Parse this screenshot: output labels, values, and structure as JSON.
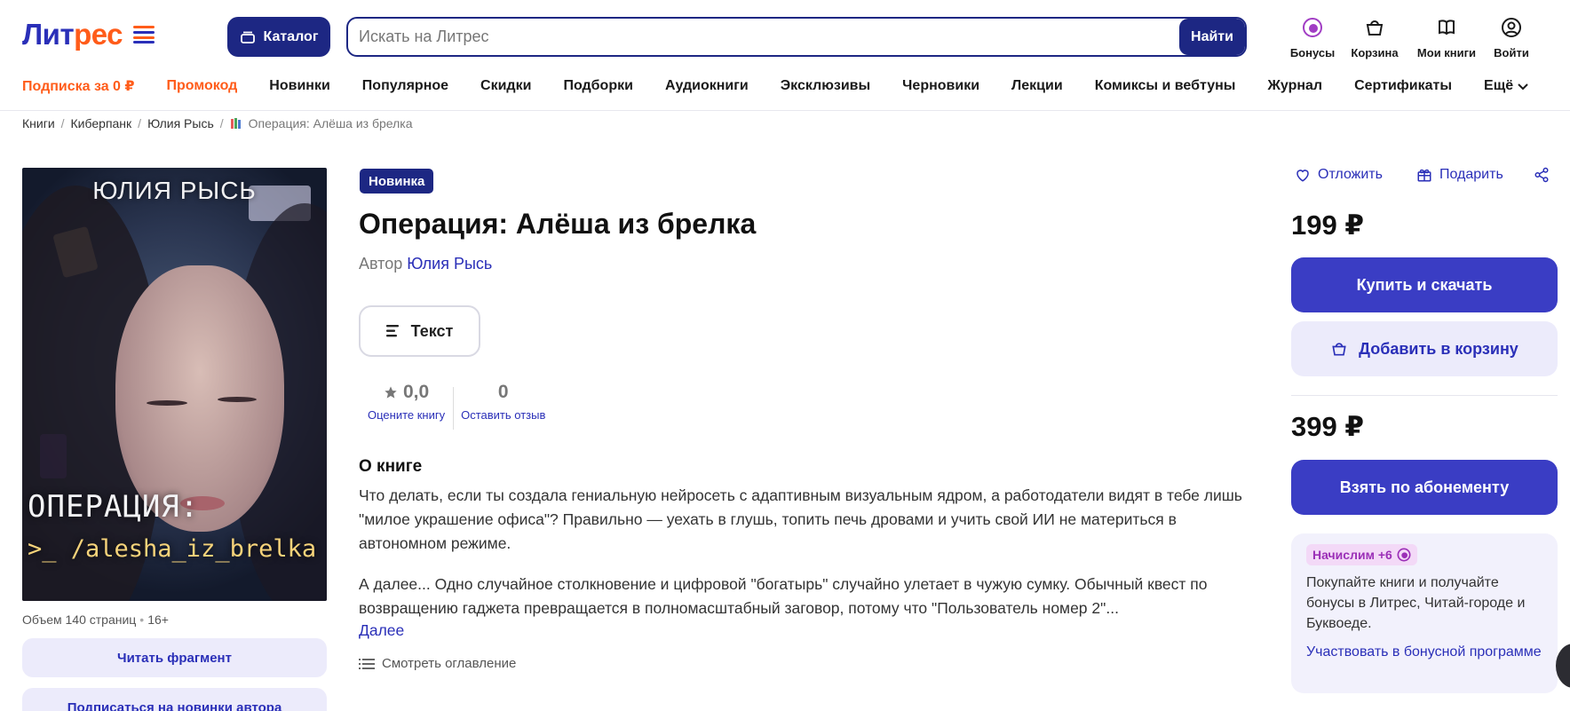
{
  "header": {
    "logo": {
      "part1": "Лит",
      "part2": "рес"
    },
    "catalog_label": "Каталог",
    "search": {
      "placeholder": "Искать на Литрес",
      "button_label": "Найти"
    },
    "actions": [
      {
        "label": "Бонусы",
        "icon": "bonus-icon"
      },
      {
        "label": "Корзина",
        "icon": "basket-icon"
      },
      {
        "label": "Мои книги",
        "icon": "book-icon"
      },
      {
        "label": "Войти",
        "icon": "user-icon"
      }
    ]
  },
  "nav": {
    "items": [
      "Подписка за 0 ₽",
      "Промокод",
      "Новинки",
      "Популярное",
      "Скидки",
      "Подборки",
      "Аудиокниги",
      "Эксклюзивы",
      "Черновики",
      "Лекции",
      "Комиксы и вебтуны",
      "Журнал",
      "Сертификаты"
    ],
    "more_label": "Ещё",
    "accent_color": "#ff5c1a"
  },
  "breadcrumb": {
    "items": [
      "Книги",
      "Киберпанк",
      "Юлия Рысь"
    ],
    "current": "Операция: Алёша из брелка"
  },
  "cover": {
    "author": "ЮЛИЯ РЫСЬ",
    "title": "ОПЕРАЦИЯ:",
    "slug": ">_ /alesha_iz_brelka"
  },
  "left": {
    "pages": "Объем 140 страниц",
    "age": "16+",
    "read_fragment": "Читать фрагмент",
    "subscribe_author": "Подписаться на новинки автора"
  },
  "book": {
    "badge": "Новинка",
    "title": "Операция: Алёша из брелка",
    "author_prefix": "Автор",
    "author_name": "Юлия Рысь",
    "format_label": "Текст",
    "rating": "0,0",
    "rate_label": "Оцените книгу",
    "reviews_count": "0",
    "review_label": "Оставить отзыв",
    "about_heading": "О книге",
    "about_p1": "Что делать, если ты создала гениальную нейросеть с адаптивным визуальным ядром, а работодатели видят в тебе лишь \"милое украшение офиса\"? Правильно — уехать в глушь, топить печь дровами и учить свой ИИ не материться в автономном режиме.",
    "about_p2": "А далее... Одно случайное столкновение и цифровой \"богатырь\" случайно улетает в чужую сумку. Обычный квест по возвращению гаджета превращается в полномасштабный заговор, потому что \"Пользователь номер 2\"...",
    "more_label": "Далее",
    "toc_label": "Смотреть оглавление"
  },
  "purchase": {
    "defer_label": "Отложить",
    "gift_label": "Подарить",
    "price_buy": "199 ₽",
    "buy_label": "Купить и скачать",
    "cart_label": "Добавить в корзину",
    "price_sub": "399 ₽",
    "sub_label": "Взять по абонементу",
    "bonus_badge": "Начислим +6",
    "bonus_text": "Покупайте книги и получайте бонусы в Литрес, Читай-городе и Буквоеде.",
    "bonus_link": "Участвовать в бонусной программе",
    "primary_color": "#3a3dc4",
    "brand_dark": "#1d2783"
  }
}
